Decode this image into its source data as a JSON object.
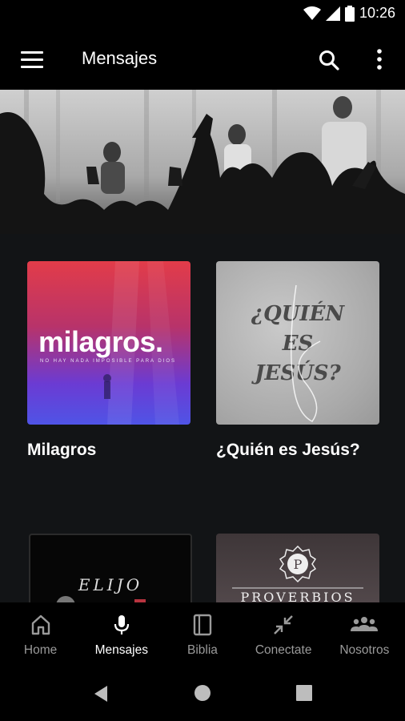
{
  "status": {
    "time": "10:26"
  },
  "appbar": {
    "title": "Mensajes"
  },
  "cards": [
    {
      "title": "Milagros",
      "thumb_main": "milagros.",
      "thumb_sub": "NO HAY NADA IMPOSIBLE PARA DIOS"
    },
    {
      "title": "¿Quién es Jesús?",
      "thumb_lines": [
        "¿QUIÉN",
        "ES",
        "JESÚS?"
      ]
    },
    {
      "thumb_text": "ELIJO"
    },
    {
      "thumb_text": "PROVERBIOS",
      "emblem_letter": "P"
    }
  ],
  "nav": {
    "items": [
      {
        "label": "Home",
        "icon": "home-icon"
      },
      {
        "label": "Mensajes",
        "icon": "microphone-icon",
        "active": true
      },
      {
        "label": "Biblia",
        "icon": "book-icon"
      },
      {
        "label": "Conectate",
        "icon": "connect-arrows-icon"
      },
      {
        "label": "Nosotros",
        "icon": "group-icon"
      }
    ]
  }
}
